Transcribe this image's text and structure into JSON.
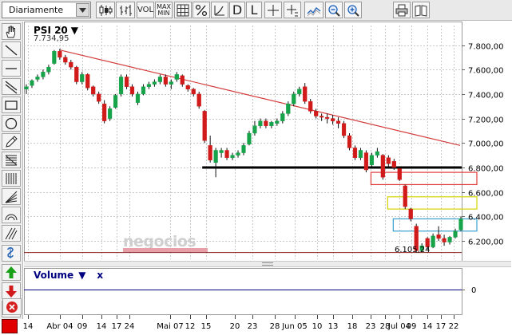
{
  "toolbar": {
    "period_label": "Diariamente",
    "vol_label": "VOL",
    "maxmin_top": "MAX",
    "maxmin_bottom": "MIN",
    "d_label": "D",
    "l_label": "L"
  },
  "chart": {
    "title": "PSI 20",
    "title_arrow": "▼",
    "last_value": "7.734,95",
    "min_label": "6.105,24",
    "watermark": "negocios",
    "colors": {
      "up": "#16a34a",
      "down": "#d11a1a",
      "resistance": "#d33b3b",
      "support": "#000000",
      "grid": "#c8c8c8"
    }
  },
  "chart_data": {
    "type": "candlestick",
    "title": "PSI 20",
    "y_ticks": [
      "7.800,00",
      "7.600,00",
      "7.400,00",
      "7.200,00",
      "7.000,00",
      "6.800,00",
      "6.600,00",
      "6.400,00",
      "6.200,00"
    ],
    "y_range": [
      6050,
      7960
    ],
    "x_tick_labels": [
      "14",
      "Abr 04",
      "09",
      "14",
      "17",
      "24",
      "Mai 07",
      "12",
      "15",
      "20",
      "23",
      "28",
      "Jun 05",
      "10",
      "13",
      "18",
      "23",
      "28",
      "Jul 04",
      "09",
      "14",
      "17",
      "22"
    ],
    "candles": [
      {
        "o": 7440,
        "h": 7480,
        "l": 7400,
        "c": 7460
      },
      {
        "o": 7470,
        "h": 7520,
        "l": 7450,
        "c": 7510
      },
      {
        "o": 7520,
        "h": 7560,
        "l": 7500,
        "c": 7540
      },
      {
        "o": 7540,
        "h": 7600,
        "l": 7520,
        "c": 7580
      },
      {
        "o": 7580,
        "h": 7640,
        "l": 7560,
        "c": 7620
      },
      {
        "o": 7650,
        "h": 7760,
        "l": 7640,
        "c": 7750
      },
      {
        "o": 7750,
        "h": 7770,
        "l": 7680,
        "c": 7700
      },
      {
        "o": 7700,
        "h": 7720,
        "l": 7640,
        "c": 7660
      },
      {
        "o": 7660,
        "h": 7680,
        "l": 7600,
        "c": 7620
      },
      {
        "o": 7620,
        "h": 7630,
        "l": 7480,
        "c": 7500
      },
      {
        "o": 7500,
        "h": 7580,
        "l": 7480,
        "c": 7560
      },
      {
        "o": 7560,
        "h": 7570,
        "l": 7430,
        "c": 7450
      },
      {
        "o": 7460,
        "h": 7470,
        "l": 7380,
        "c": 7400
      },
      {
        "o": 7400,
        "h": 7420,
        "l": 7320,
        "c": 7340
      },
      {
        "o": 7320,
        "h": 7350,
        "l": 7160,
        "c": 7180
      },
      {
        "o": 7200,
        "h": 7300,
        "l": 7180,
        "c": 7280
      },
      {
        "o": 7290,
        "h": 7400,
        "l": 7280,
        "c": 7390
      },
      {
        "o": 7400,
        "h": 7560,
        "l": 7380,
        "c": 7540
      },
      {
        "o": 7540,
        "h": 7560,
        "l": 7440,
        "c": 7460
      },
      {
        "o": 7460,
        "h": 7480,
        "l": 7380,
        "c": 7400
      },
      {
        "o": 7330,
        "h": 7420,
        "l": 7310,
        "c": 7400
      },
      {
        "o": 7400,
        "h": 7480,
        "l": 7390,
        "c": 7460
      },
      {
        "o": 7460,
        "h": 7500,
        "l": 7440,
        "c": 7480
      },
      {
        "o": 7480,
        "h": 7520,
        "l": 7460,
        "c": 7500
      },
      {
        "o": 7500,
        "h": 7560,
        "l": 7480,
        "c": 7540
      },
      {
        "o": 7540,
        "h": 7560,
        "l": 7460,
        "c": 7480
      },
      {
        "o": 7480,
        "h": 7520,
        "l": 7440,
        "c": 7500
      },
      {
        "o": 7520,
        "h": 7580,
        "l": 7500,
        "c": 7560
      },
      {
        "o": 7550,
        "h": 7560,
        "l": 7460,
        "c": 7480
      },
      {
        "o": 7470,
        "h": 7480,
        "l": 7420,
        "c": 7440
      },
      {
        "o": 7440,
        "h": 7450,
        "l": 7380,
        "c": 7400
      },
      {
        "o": 7400,
        "h": 7420,
        "l": 7280,
        "c": 7300
      },
      {
        "o": 7260,
        "h": 7270,
        "l": 7000,
        "c": 7020
      },
      {
        "o": 6980,
        "h": 7060,
        "l": 6840,
        "c": 6860
      },
      {
        "o": 6840,
        "h": 6960,
        "l": 6720,
        "c": 6940
      },
      {
        "o": 6920,
        "h": 6960,
        "l": 6880,
        "c": 6940
      },
      {
        "o": 6940,
        "h": 6960,
        "l": 6860,
        "c": 6880
      },
      {
        "o": 6880,
        "h": 6920,
        "l": 6860,
        "c": 6900
      },
      {
        "o": 6900,
        "h": 6940,
        "l": 6880,
        "c": 6920
      },
      {
        "o": 6920,
        "h": 7000,
        "l": 6900,
        "c": 6980
      },
      {
        "o": 6990,
        "h": 7100,
        "l": 6980,
        "c": 7080
      },
      {
        "o": 7080,
        "h": 7180,
        "l": 7060,
        "c": 7140
      },
      {
        "o": 7140,
        "h": 7200,
        "l": 7120,
        "c": 7180
      },
      {
        "o": 7180,
        "h": 7200,
        "l": 7120,
        "c": 7140
      },
      {
        "o": 7140,
        "h": 7180,
        "l": 7120,
        "c": 7170
      },
      {
        "o": 7160,
        "h": 7200,
        "l": 7140,
        "c": 7180
      },
      {
        "o": 7180,
        "h": 7260,
        "l": 7160,
        "c": 7240
      },
      {
        "o": 7240,
        "h": 7340,
        "l": 7220,
        "c": 7320
      },
      {
        "o": 7320,
        "h": 7420,
        "l": 7300,
        "c": 7400
      },
      {
        "o": 7400,
        "h": 7460,
        "l": 7380,
        "c": 7440
      },
      {
        "o": 7460,
        "h": 7490,
        "l": 7320,
        "c": 7340
      },
      {
        "o": 7340,
        "h": 7360,
        "l": 7240,
        "c": 7260
      },
      {
        "o": 7260,
        "h": 7280,
        "l": 7200,
        "c": 7220
      },
      {
        "o": 7220,
        "h": 7240,
        "l": 7180,
        "c": 7210
      },
      {
        "o": 7210,
        "h": 7240,
        "l": 7160,
        "c": 7200
      },
      {
        "o": 7200,
        "h": 7230,
        "l": 7150,
        "c": 7180
      },
      {
        "o": 7180,
        "h": 7210,
        "l": 7120,
        "c": 7160
      },
      {
        "o": 7160,
        "h": 7180,
        "l": 7040,
        "c": 7060
      },
      {
        "o": 7060,
        "h": 7080,
        "l": 6940,
        "c": 6960
      },
      {
        "o": 6960,
        "h": 6980,
        "l": 6860,
        "c": 6880
      },
      {
        "o": 6880,
        "h": 6960,
        "l": 6860,
        "c": 6940
      },
      {
        "o": 6920,
        "h": 6940,
        "l": 6760,
        "c": 6780
      },
      {
        "o": 6820,
        "h": 6920,
        "l": 6800,
        "c": 6900
      },
      {
        "o": 6900,
        "h": 6960,
        "l": 6880,
        "c": 6930
      },
      {
        "o": 6900,
        "h": 6910,
        "l": 6700,
        "c": 6720
      },
      {
        "o": 6880,
        "h": 6900,
        "l": 6800,
        "c": 6830
      },
      {
        "o": 6850,
        "h": 6870,
        "l": 6780,
        "c": 6800
      },
      {
        "o": 6790,
        "h": 6800,
        "l": 6690,
        "c": 6700
      },
      {
        "o": 6650,
        "h": 6660,
        "l": 6460,
        "c": 6480
      },
      {
        "o": 6460,
        "h": 6470,
        "l": 6360,
        "c": 6380
      },
      {
        "o": 6320,
        "h": 6340,
        "l": 6105,
        "c": 6120
      },
      {
        "o": 6120,
        "h": 6180,
        "l": 6110,
        "c": 6160
      },
      {
        "o": 6220,
        "h": 6230,
        "l": 6130,
        "c": 6150
      },
      {
        "o": 6150,
        "h": 6260,
        "l": 6140,
        "c": 6240
      },
      {
        "o": 6250,
        "h": 6320,
        "l": 6200,
        "c": 6220
      },
      {
        "o": 6220,
        "h": 6250,
        "l": 6160,
        "c": 6190
      },
      {
        "o": 6190,
        "h": 6240,
        "l": 6170,
        "c": 6230
      },
      {
        "o": 6230,
        "h": 6300,
        "l": 6220,
        "c": 6280
      },
      {
        "o": 6290,
        "h": 6400,
        "l": 6280,
        "c": 6380
      }
    ],
    "trendline": {
      "from": 7760,
      "to": 6980
    },
    "support_level": 6800,
    "min_level": 6105,
    "zones": [
      {
        "top": 6760,
        "bottom": 6660,
        "color": "#e03a3a"
      },
      {
        "top": 6560,
        "bottom": 6460,
        "color": "#d4d400"
      },
      {
        "top": 6380,
        "bottom": 6280,
        "color": "#3aa0d0"
      }
    ]
  },
  "volume": {
    "label": "Volume",
    "arrow": "▼",
    "close": "x",
    "zero_label": "0"
  }
}
